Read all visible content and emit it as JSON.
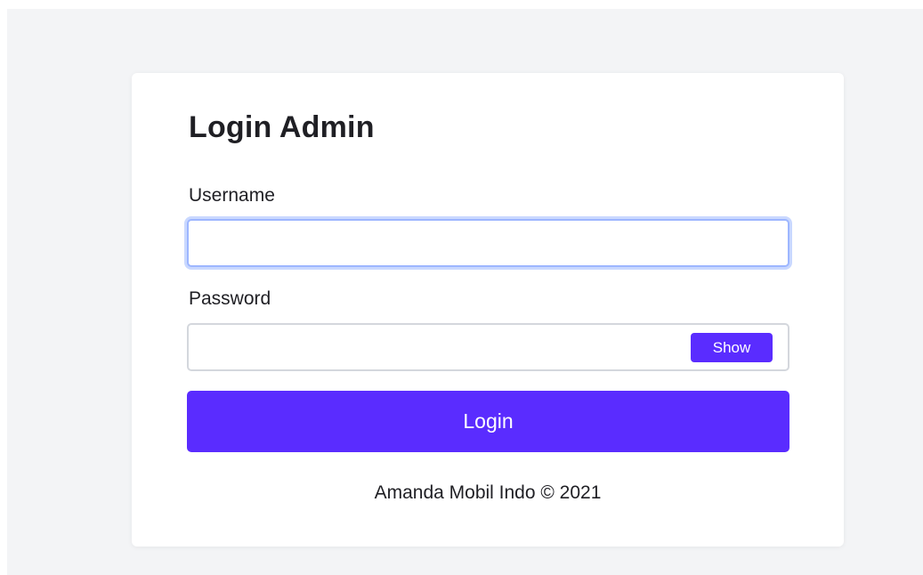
{
  "login": {
    "title": "Login Admin",
    "username_label": "Username",
    "username_value": "",
    "password_label": "Password",
    "password_value": "",
    "show_label": "Show",
    "submit_label": "Login"
  },
  "footer": {
    "text": "Amanda Mobil Indo © 2021"
  },
  "colors": {
    "background": "#f3f4f6",
    "card": "#ffffff",
    "primary": "#5a2cff",
    "focus_ring": "#9db6ff",
    "text": "#1f1f24"
  }
}
